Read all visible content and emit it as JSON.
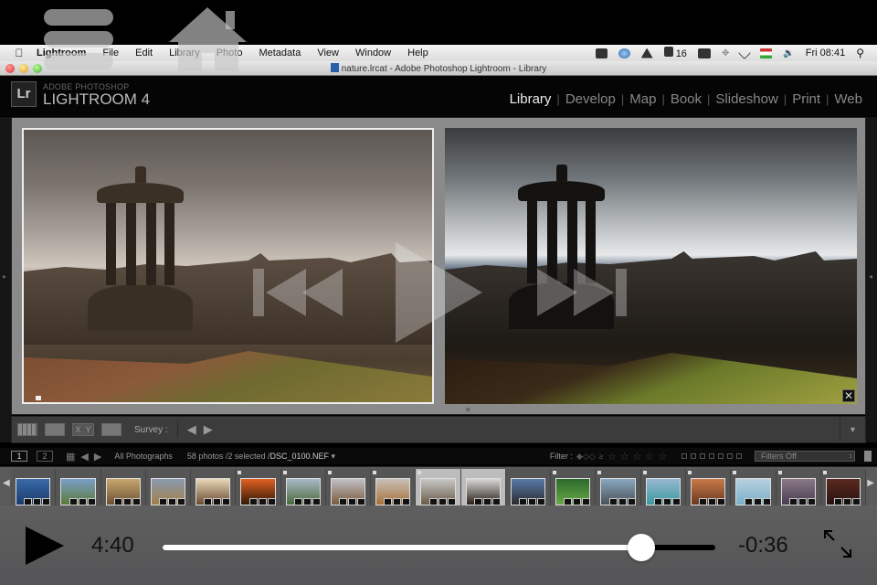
{
  "menubar": {
    "apple_icon": "apple-logo-icon",
    "items": [
      "Lightroom",
      "File",
      "Edit",
      "Library",
      "Photo",
      "Metadata",
      "View",
      "Window",
      "Help"
    ],
    "tray": {
      "icons": [
        "facetime-camera-icon",
        "dropbox-icon",
        "google-drive-icon",
        "adobe-cc-icon"
      ],
      "adobe_count": "16",
      "icons2": [
        "display-icon",
        "bluetooth-icon",
        "wifi-icon",
        "hungarian-flag-icon",
        "volume-icon"
      ],
      "clock": "Fri 08:41",
      "search_icon": "spotlight-search-icon"
    }
  },
  "window": {
    "title": "nature.lrcat - Adobe Photoshop Lightroom - Library"
  },
  "identity": {
    "badge": "Lr",
    "subtitle": "ADOBE PHOTOSHOP",
    "name": "LIGHTROOM 4",
    "modules": [
      "Library",
      "Develop",
      "Map",
      "Book",
      "Slideshow",
      "Print",
      "Web"
    ],
    "active_module": "Library",
    "separator": "|"
  },
  "main": {
    "view": "Survey",
    "photos": [
      {
        "name": "survey-photo-1",
        "selected": true
      },
      {
        "name": "survey-photo-2",
        "selected": false
      }
    ],
    "close_glyph": "✕",
    "reject_glyph": "✕"
  },
  "toolbar": {
    "grid_icon": "grid-view-icon",
    "loupe_icon": "loupe-view-icon",
    "compare_x": "X",
    "compare_y": "Y",
    "survey_icon": "survey-view-icon",
    "survey_label": "Survey :",
    "prev_glyph": "◀",
    "next_glyph": "▶",
    "menu_glyph": "▼"
  },
  "filmstrip_header": {
    "screen1": "1",
    "screen2": "2",
    "grid_glyph": "▦",
    "back_glyph": "◀",
    "forward_glyph": "▶",
    "source": "All Photographs",
    "count": "58 photos /2 selected /",
    "filename": "DSC_0100.NEF",
    "dropdown_glyph": "▾",
    "filter_label": "Filter :",
    "stars": [
      "☆",
      "☆",
      "☆",
      "☆",
      "☆"
    ],
    "ge_glyph": "≥",
    "color_labels": [
      "#8a3a3a",
      "#8a8a3a",
      "#3a7a3a",
      "#3a4a8a",
      "#6a3a8a",
      "#777777",
      "#555555"
    ],
    "filters_select": "Filters Off"
  },
  "filmstrip": {
    "left_arrow": "◀",
    "right_arrow": "▶",
    "thumbnails": [
      {
        "colors": [
          "#3a6aa8",
          "#1a3a6a"
        ],
        "selected": false,
        "picked": false
      },
      {
        "colors": [
          "#7aa0c8",
          "#5a7a3a"
        ],
        "selected": false,
        "picked": false
      },
      {
        "colors": [
          "#c8a870",
          "#6a5030"
        ],
        "selected": false,
        "picked": false
      },
      {
        "colors": [
          "#8a9ab0",
          "#a08048"
        ],
        "selected": false,
        "picked": false
      },
      {
        "colors": [
          "#e8d8b8",
          "#6a4a30"
        ],
        "selected": false,
        "picked": false
      },
      {
        "colors": [
          "#e06020",
          "#301808"
        ],
        "selected": false,
        "picked": true
      },
      {
        "colors": [
          "#a8b8c8",
          "#4a6a3a"
        ],
        "selected": false,
        "picked": true
      },
      {
        "colors": [
          "#c0c0c8",
          "#7a5a3a"
        ],
        "selected": false,
        "picked": true
      },
      {
        "colors": [
          "#c8c0b8",
          "#a8703a"
        ],
        "selected": false,
        "picked": true
      },
      {
        "colors": [
          "#c8c8c8",
          "#6a5a48"
        ],
        "selected": true,
        "picked": true
      },
      {
        "colors": [
          "#d8d8d8",
          "#2a2018"
        ],
        "selected": true,
        "picked": false
      },
      {
        "colors": [
          "#5a7aa8",
          "#2a2a30"
        ],
        "selected": false,
        "picked": false
      },
      {
        "colors": [
          "#2a6a2a",
          "#6aa848"
        ],
        "selected": false,
        "picked": true
      },
      {
        "colors": [
          "#8aa8c0",
          "#4a5058"
        ],
        "selected": false,
        "picked": true
      },
      {
        "colors": [
          "#98b8d0",
          "#3a9aa0"
        ],
        "selected": false,
        "picked": true
      },
      {
        "colors": [
          "#c87a48",
          "#6a3820"
        ],
        "selected": false,
        "picked": true
      },
      {
        "colors": [
          "#b8d0e0",
          "#7ab0c8"
        ],
        "selected": false,
        "picked": true
      },
      {
        "colors": [
          "#8a7a88",
          "#4a3a50"
        ],
        "selected": false,
        "picked": true
      },
      {
        "colors": [
          "#5a2a20",
          "#2a1210"
        ],
        "selected": false,
        "picked": true
      }
    ]
  },
  "player": {
    "play_icon": "play-icon",
    "elapsed": "4:40",
    "remaining": "-0:36",
    "progress": 0.866,
    "fullscreen_icon": "expand-fullscreen-icon"
  },
  "overlay": {
    "list_icon": "list-menu-icon",
    "home_icon": "home-icon",
    "rewind_icon": "skip-back-icon",
    "play_icon": "overlay-play-icon",
    "forward_icon": "skip-forward-icon"
  }
}
